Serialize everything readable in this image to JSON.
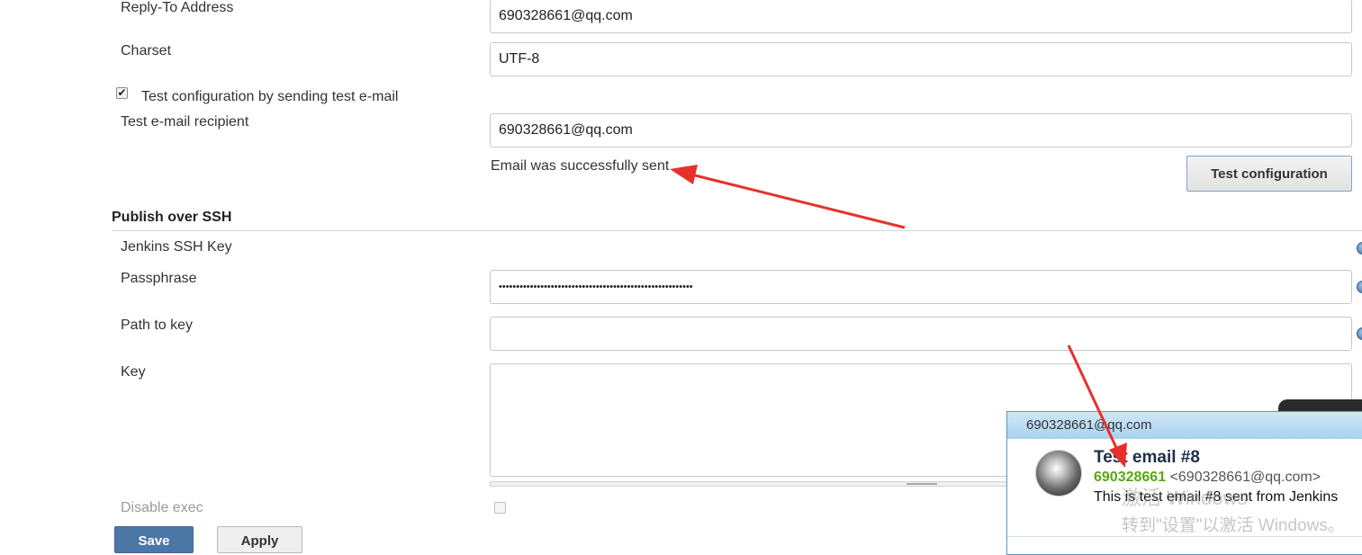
{
  "form": {
    "reply_to": {
      "label": "Reply-To Address",
      "value": "690328661@qq.com"
    },
    "charset": {
      "label": "Charset",
      "value": "UTF-8"
    },
    "test_checkbox": {
      "label": "Test configuration by sending test e-mail",
      "checked": true
    },
    "test_recipient": {
      "label": "Test e-mail recipient",
      "value": "690328661@qq.com"
    },
    "success_message": "Email was successfully sent",
    "test_button": "Test configuration"
  },
  "ssh": {
    "section_title": "Publish over SSH",
    "ssh_key_label": "Jenkins SSH Key",
    "passphrase": {
      "label": "Passphrase",
      "value": "••••••••••••••••••••••••••••••••••••••••••••••••••••••••"
    },
    "path_to_key": {
      "label": "Path to key",
      "value": ""
    },
    "key": {
      "label": "Key",
      "value": ""
    },
    "disable_exec": {
      "label": "Disable exec",
      "checked": false
    }
  },
  "buttons": {
    "save": "Save",
    "apply": "Apply"
  },
  "notification": {
    "header": "690328661@qq.com",
    "subject": "Test email #8",
    "sender_name": "690328661",
    "sender_email": "<690328661@qq.com>",
    "body": "This is test email #8 sent from Jenkins"
  },
  "watermark": {
    "line1": "激活 Windows",
    "line2": "转到\"设置\"以激活 Windows。"
  },
  "colors": {
    "annotation_arrow": "#e8302a",
    "sender_green": "#5aa617",
    "save_button": "#4b77a6",
    "success_text": "#333333"
  }
}
